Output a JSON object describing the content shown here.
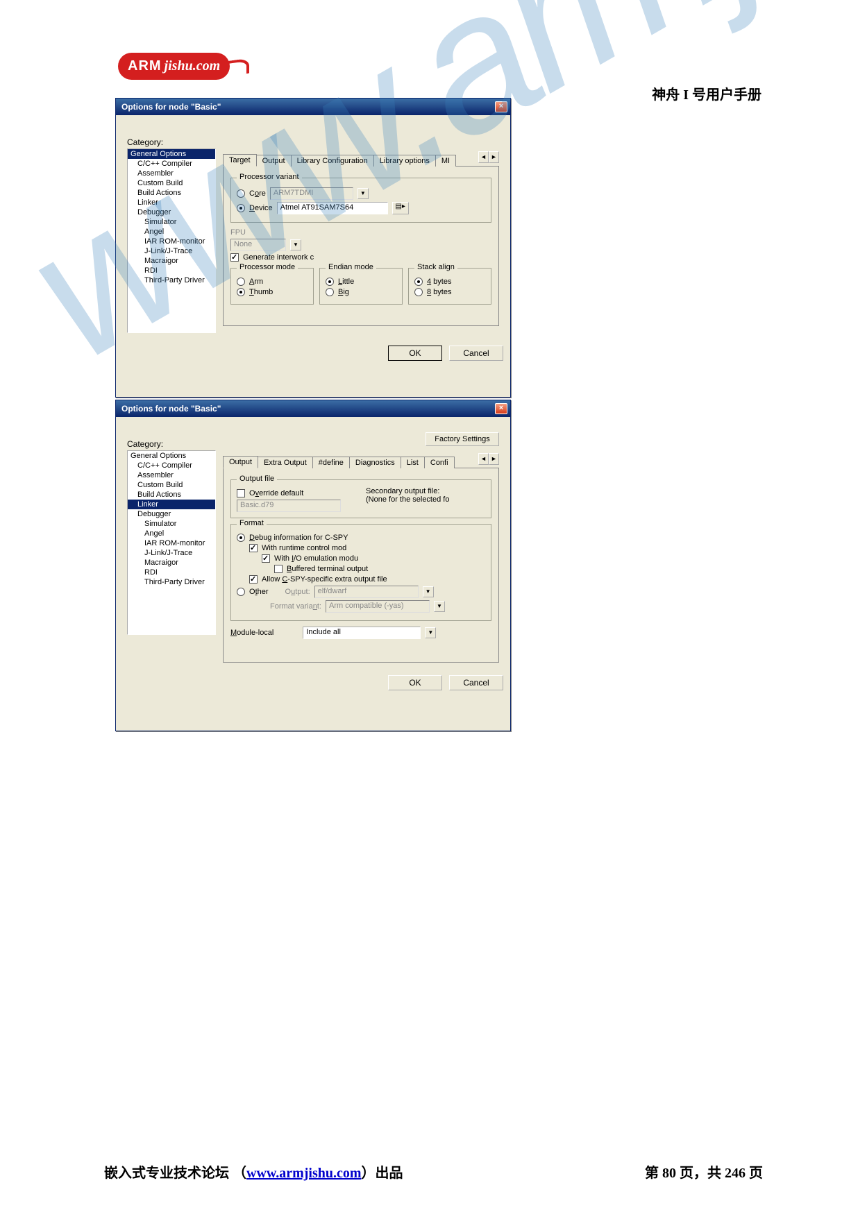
{
  "doc": {
    "logo_text1": "ARM",
    "logo_text2": "jishu.com",
    "manual_title": "神舟 I 号用户手册",
    "footer_left_1": "嵌入式专业技术论坛 （",
    "footer_link": "www.armjishu.com",
    "footer_left_2": "）出品",
    "footer_right": "第 80 页，共 246 页",
    "watermark": "www.armjishu.com"
  },
  "dialog1": {
    "title": "Options for node \"Basic\"",
    "category_label": "Category:",
    "categories": [
      "General Options",
      "C/C++ Compiler",
      "Assembler",
      "Custom Build",
      "Build Actions",
      "Linker",
      "Debugger",
      "Simulator",
      "Angel",
      "IAR ROM-monitor",
      "J-Link/J-Trace",
      "Macraigor",
      "RDI",
      "Third-Party Driver"
    ],
    "selected_category": "General Options",
    "tabs": [
      "Target",
      "Output",
      "Library Configuration",
      "Library options",
      "MI"
    ],
    "active_tab": "Target",
    "processor_variant": {
      "legend": "Processor variant",
      "core_label": "Core",
      "core_value": "ARM7TDMI",
      "device_label": "Device",
      "device_value": "Atmel AT91SAM7S64",
      "core_selected": false,
      "device_selected": true
    },
    "fpu": {
      "label": "FPU",
      "value": "None"
    },
    "generate_interwork": {
      "label": "Generate interwork c",
      "checked": true
    },
    "processor_mode": {
      "legend": "Processor mode",
      "arm": "Arm",
      "thumb": "Thumb",
      "selected": "Thumb"
    },
    "endian_mode": {
      "legend": "Endian mode",
      "little": "Little",
      "big": "Big",
      "selected": "Little"
    },
    "stack_align": {
      "legend": "Stack align",
      "b4": "4 bytes",
      "b8": "8 bytes",
      "selected": "4 bytes"
    },
    "ok": "OK",
    "cancel": "Cancel"
  },
  "dialog2": {
    "title": "Options for node \"Basic\"",
    "category_label": "Category:",
    "factory": "Factory Settings",
    "categories": [
      "General Options",
      "C/C++ Compiler",
      "Assembler",
      "Custom Build",
      "Build Actions",
      "Linker",
      "Debugger",
      "Simulator",
      "Angel",
      "IAR ROM-monitor",
      "J-Link/J-Trace",
      "Macraigor",
      "RDI",
      "Third-Party Driver"
    ],
    "selected_category": "Linker",
    "tabs": [
      "Output",
      "Extra Output",
      "#define",
      "Diagnostics",
      "List",
      "Confi"
    ],
    "active_tab": "Output",
    "output_file": {
      "legend": "Output file",
      "override_label": "Override default",
      "override_checked": false,
      "value": "Basic.d79",
      "secondary_label": "Secondary output file:",
      "secondary_note": "(None for the selected fo"
    },
    "format": {
      "legend": "Format",
      "cspy_label": "Debug information for C-SPY",
      "cspy_selected": true,
      "runtime_label": "With runtime control mod",
      "runtime_checked": true,
      "io_label": "With I/O emulation modu",
      "io_checked": true,
      "buffered_label": "Buffered terminal output",
      "buffered_checked": false,
      "allow_label": "Allow C-SPY-specific extra output file",
      "allow_checked": true,
      "other_label": "Other",
      "other_selected": false,
      "output_label": "Output:",
      "output_value": "elf/dwarf",
      "variant_label": "Format variant:",
      "variant_value": "Arm compatible (-yas)"
    },
    "module_local": {
      "label": "Module-local",
      "value": "Include all"
    },
    "ok": "OK",
    "cancel": "Cancel"
  }
}
